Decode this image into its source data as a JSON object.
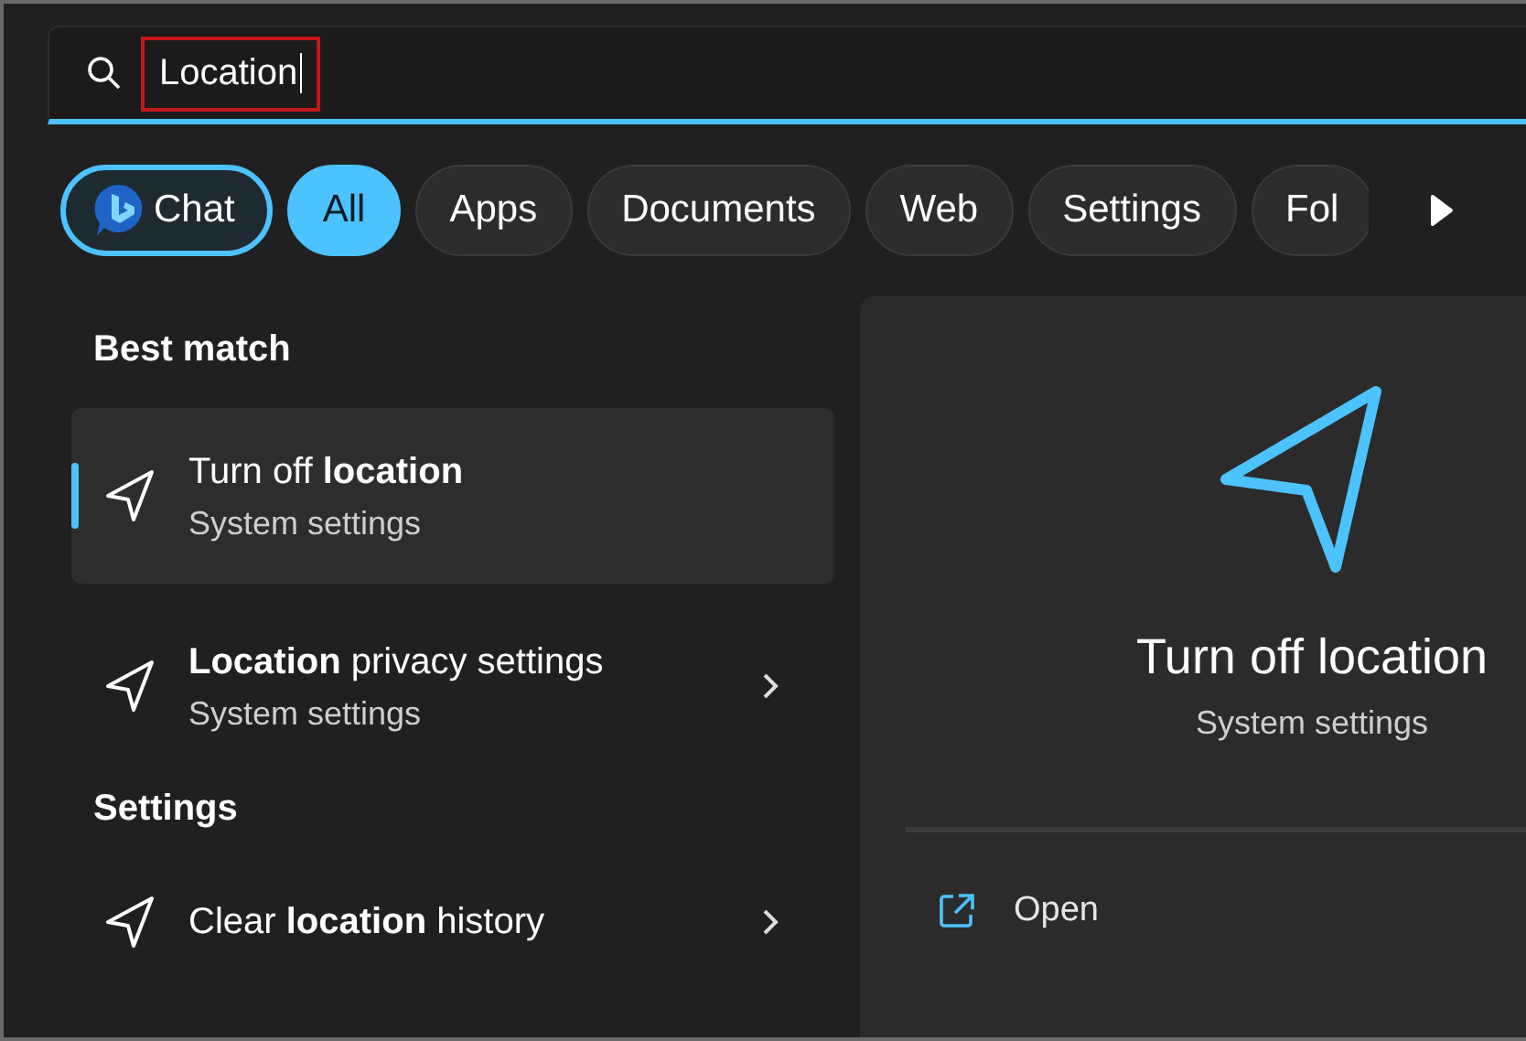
{
  "search": {
    "value": "Location",
    "highlighted": true,
    "cursor": true
  },
  "filters": [
    {
      "label": "Chat",
      "kind": "chat",
      "selected": false
    },
    {
      "label": "All",
      "kind": "chip",
      "selected": true
    },
    {
      "label": "Apps",
      "kind": "chip",
      "selected": false
    },
    {
      "label": "Documents",
      "kind": "chip",
      "selected": false
    },
    {
      "label": "Web",
      "kind": "chip",
      "selected": false
    },
    {
      "label": "Settings",
      "kind": "chip",
      "selected": false
    },
    {
      "label": "Fol",
      "kind": "chip",
      "selected": false
    }
  ],
  "sections": [
    {
      "heading": "Best match",
      "items": [
        {
          "title": "Turn off **location**",
          "subtitle": "System settings",
          "selected": true,
          "chevron": false
        },
        {
          "title": "**Location** privacy settings",
          "subtitle": "System settings",
          "selected": false,
          "chevron": true
        }
      ]
    },
    {
      "heading": "Settings",
      "items": [
        {
          "title": "Clear **location** history",
          "selected": false,
          "chevron": true
        }
      ]
    }
  ],
  "preview": {
    "title": "Turn off location",
    "subtitle": "System settings",
    "actions": [
      {
        "label": "Open"
      }
    ]
  }
}
